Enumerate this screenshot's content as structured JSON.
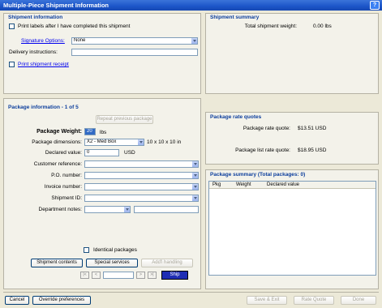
{
  "window": {
    "title": "Multiple-Piece Shipment Information",
    "help_label": "?"
  },
  "shipment_info": {
    "title": "Shipment information",
    "print_labels_label": "Print labels after I have completed this shipment",
    "signature_label": "Signature Options:",
    "signature_value": "None",
    "delivery_label": "Delivery instructions:",
    "delivery_value": "",
    "print_receipt_label": "Print shipment receipt"
  },
  "shipment_summary": {
    "title": "Shipment summary",
    "total_weight_label": "Total shipment weight:",
    "total_weight_value": "0.00 lbs"
  },
  "package_info": {
    "title": "Package information - 1 of 5",
    "repeat_label": "Repeat previous package",
    "weight_label": "Package Weight:",
    "weight_value": "20",
    "weight_unit": "lbs",
    "dimensions_label": "Package dimensions:",
    "dimensions_value": "X2 - Med Box",
    "dimensions_size": "10 x 10 x 10 in",
    "declared_label": "Declared value:",
    "declared_value": "0",
    "declared_unit": "USD",
    "customer_ref_label": "Customer reference:",
    "po_label": "P.O. number:",
    "invoice_label": "Invoice number:",
    "shipment_id_label": "Shipment ID:",
    "dept_label": "Department notes:",
    "identical_label": "Identical packages",
    "shipment_contents_label": "Shipment contents",
    "special_services_label": "Special services",
    "add_handling_label": "Add'l handling",
    "ship_label": "Ship",
    "nav_first": "|<",
    "nav_prev": "<",
    "nav_next": ">",
    "nav_last": ">|"
  },
  "rate_quotes": {
    "title": "Package rate quotes",
    "rate_label": "Package rate quote:",
    "rate_value": "$13.51 USD",
    "list_label": "Package list rate quote:",
    "list_value": "$18.95 USD"
  },
  "package_summary": {
    "title": "Package summary (Total packages: 0)",
    "columns": [
      "Pkg",
      "Weight",
      "Declared value"
    ]
  },
  "footer": {
    "cancel_label": "Cancel",
    "override_label": "Override preferences",
    "save_exit_label": "Save & Exit",
    "rate_quote_label": "Rate Quote",
    "done_label": "Done"
  }
}
